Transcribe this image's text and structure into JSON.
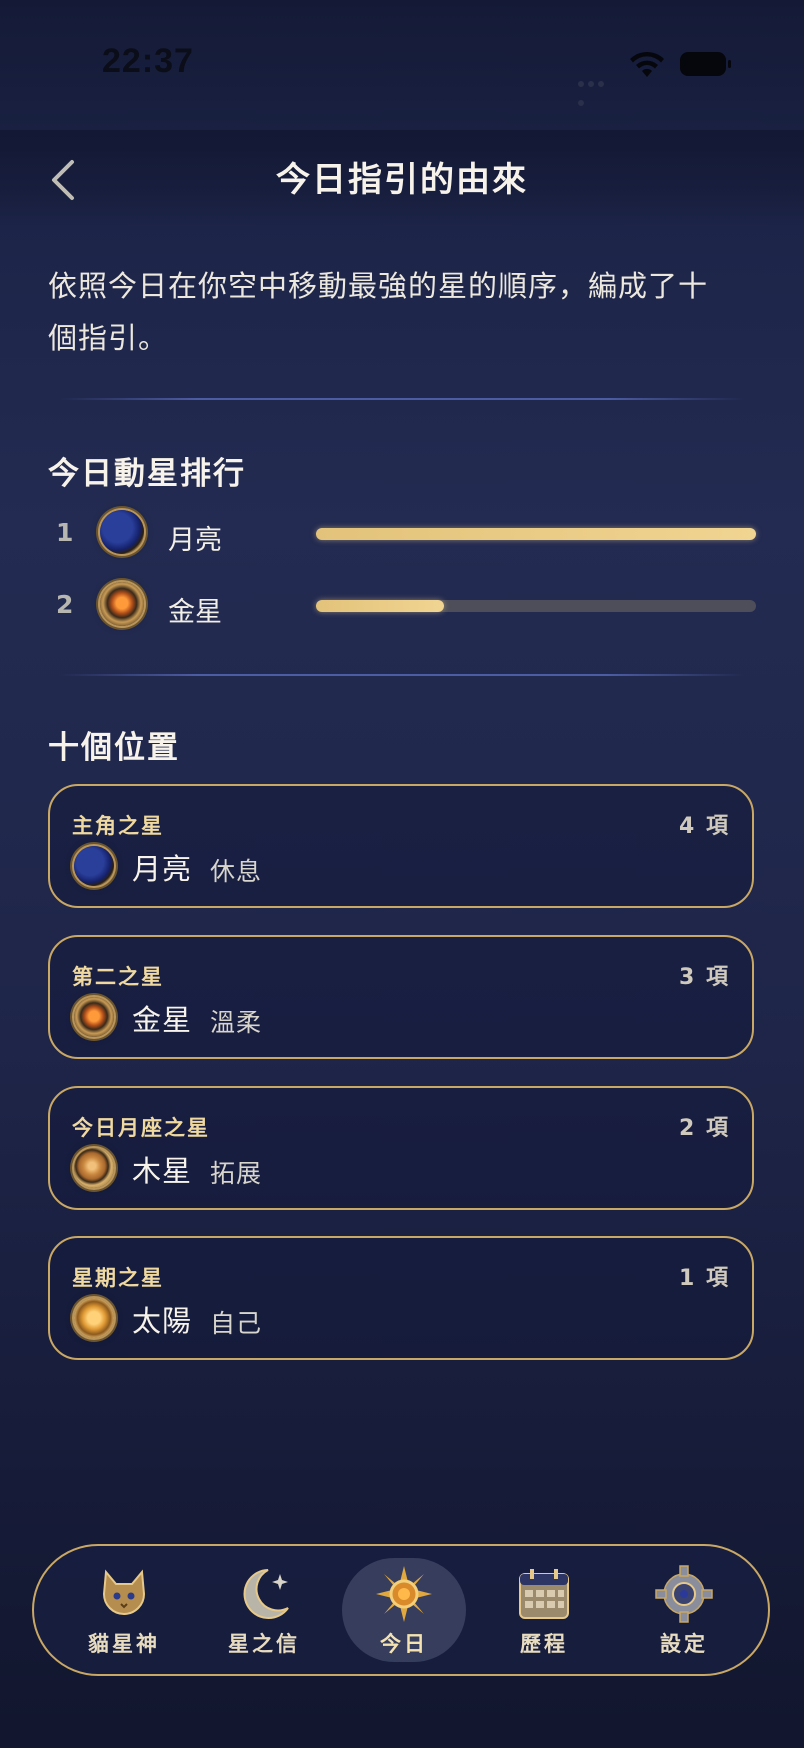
{
  "status_bar": {
    "time": "22:37"
  },
  "header": {
    "title": "今日指引的由來"
  },
  "intro": "依照今日在你空中移動最強的星的順序，編成了十個指引。",
  "ranking": {
    "title": "今日動星排行",
    "items": [
      {
        "rank": "1",
        "planet": "月亮",
        "icon": "moon-icon",
        "strength": 1.0
      },
      {
        "rank": "2",
        "planet": "金星",
        "icon": "venus-icon",
        "strength": 0.29
      }
    ]
  },
  "positions": {
    "title": "十個位置",
    "items": [
      {
        "title": "主角之星",
        "count": "4 項",
        "planet": "月亮",
        "keyword": "休息",
        "icon": "moon-icon"
      },
      {
        "title": "第二之星",
        "count": "3 項",
        "planet": "金星",
        "keyword": "溫柔",
        "icon": "venus-icon"
      },
      {
        "title": "今日月座之星",
        "count": "2 項",
        "planet": "木星",
        "keyword": "拓展",
        "icon": "jupiter-icon"
      },
      {
        "title": "星期之星",
        "count": "1 項",
        "planet": "太陽",
        "keyword": "自己",
        "icon": "sun-icon"
      }
    ]
  },
  "tabs": [
    {
      "label": "貓星神",
      "icon": "cat-icon",
      "active": false
    },
    {
      "label": "星之信",
      "icon": "crescent-moon-icon",
      "active": false
    },
    {
      "label": "今日",
      "icon": "sun-icon",
      "active": true
    },
    {
      "label": "歷程",
      "icon": "calendar-icon",
      "active": false
    },
    {
      "label": "設定",
      "icon": "gear-icon",
      "active": false
    }
  ],
  "colors": {
    "gold": "#c9a764",
    "bar_fill": "#e3c37b",
    "background": "#1e2548"
  }
}
